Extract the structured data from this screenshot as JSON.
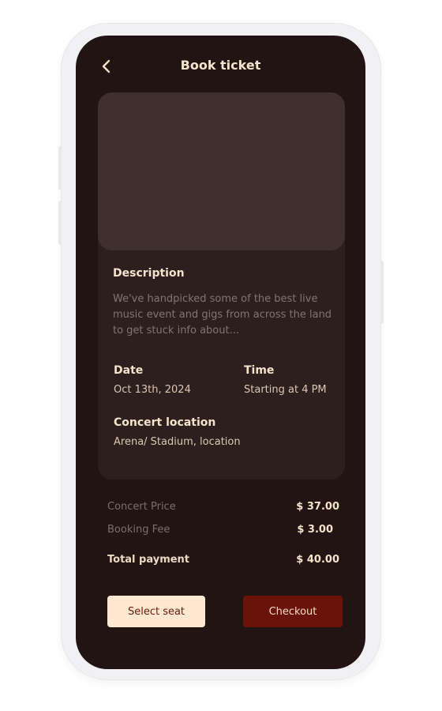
{
  "header": {
    "title": "Book ticket",
    "back_icon": "chevron-left-icon"
  },
  "event": {
    "description_title": "Description",
    "description_text": "We've handpicked some of the best live music event and gigs from across the land to get stuck info about...",
    "date_label": "Date",
    "date_value": "Oct 13th, 2024",
    "time_label": "Time",
    "time_value": "Starting at 4 PM",
    "location_label": "Concert location",
    "location_value": "Arena/ Stadium, location"
  },
  "pricing": {
    "concert_price_label": "Concert Price",
    "concert_price_value": "$ 37.00",
    "booking_fee_label": "Booking Fee",
    "booking_fee_value": "$ 3.00",
    "total_label": "Total payment",
    "total_value": "$ 40.00"
  },
  "actions": {
    "select_seat_label": "Select seat",
    "checkout_label": "Checkout"
  },
  "colors": {
    "background": "#231414",
    "card": "#2c1f1e",
    "accent_primary": "#6a1409",
    "accent_light": "#ffe8cf",
    "text_primary": "#f3e3cc"
  }
}
